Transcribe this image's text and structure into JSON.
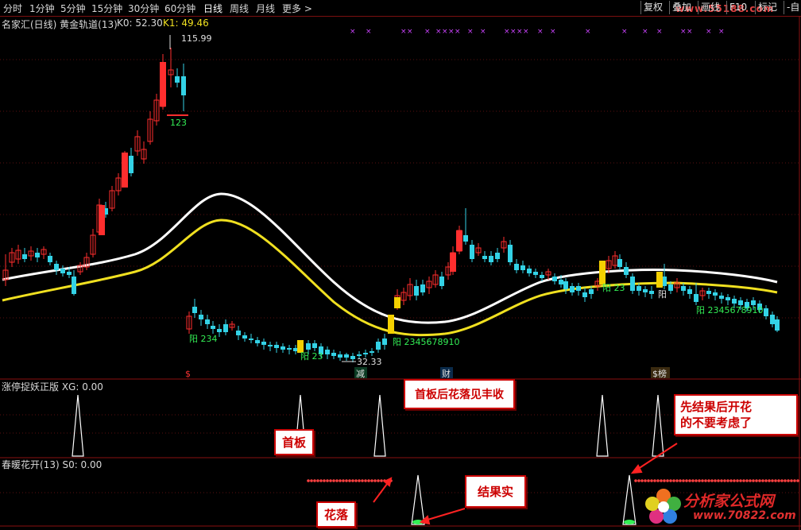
{
  "toolbar": {
    "periods": [
      "分时",
      "1分钟",
      "5分钟",
      "15分钟",
      "30分钟",
      "60分钟",
      "日线",
      "周线",
      "月线",
      "更多 >"
    ],
    "active_period": "日线",
    "buttons": [
      "复权",
      "叠加",
      "画线",
      "F10",
      "标记",
      "-自"
    ]
  },
  "watermark": "www.55188.com",
  "main_panel": {
    "title": "名家汇(日线) 黄金轨道(13)",
    "k0": "K0: 52.30",
    "k1": "K1: 49.46",
    "high_label": "115.99",
    "low_label": "32.33",
    "count_labels": [
      "123",
      "阳 234",
      "阳 23",
      "阳 2345678910",
      "阳 23",
      "阳",
      "阳 2345678910"
    ],
    "markers": [
      "$",
      "减",
      "财",
      "$榜"
    ]
  },
  "xg_panel": {
    "title": "涨停捉妖正版 XG: 0.00"
  },
  "s0_panel": {
    "title": "春暖花开(13) S0: 0.00"
  },
  "annotations": {
    "first_board_harvest": "首板后花落见丰收",
    "first_board": "首板",
    "result_first": "先结果后开花",
    "no_consider": "的不要考虑了",
    "flower_fall": "花落",
    "fruit": "结果实"
  },
  "logo": {
    "title": "分析家公式网",
    "url": "www.70822.com"
  },
  "colors": {
    "up": "#ff2e2e",
    "down": "#33d2e6",
    "white_track": "#ffffff",
    "yellow_track": "#f0e020",
    "label_green": "#33ee55",
    "x_marks": "#cc44ff",
    "border": "#8a1010"
  }
}
